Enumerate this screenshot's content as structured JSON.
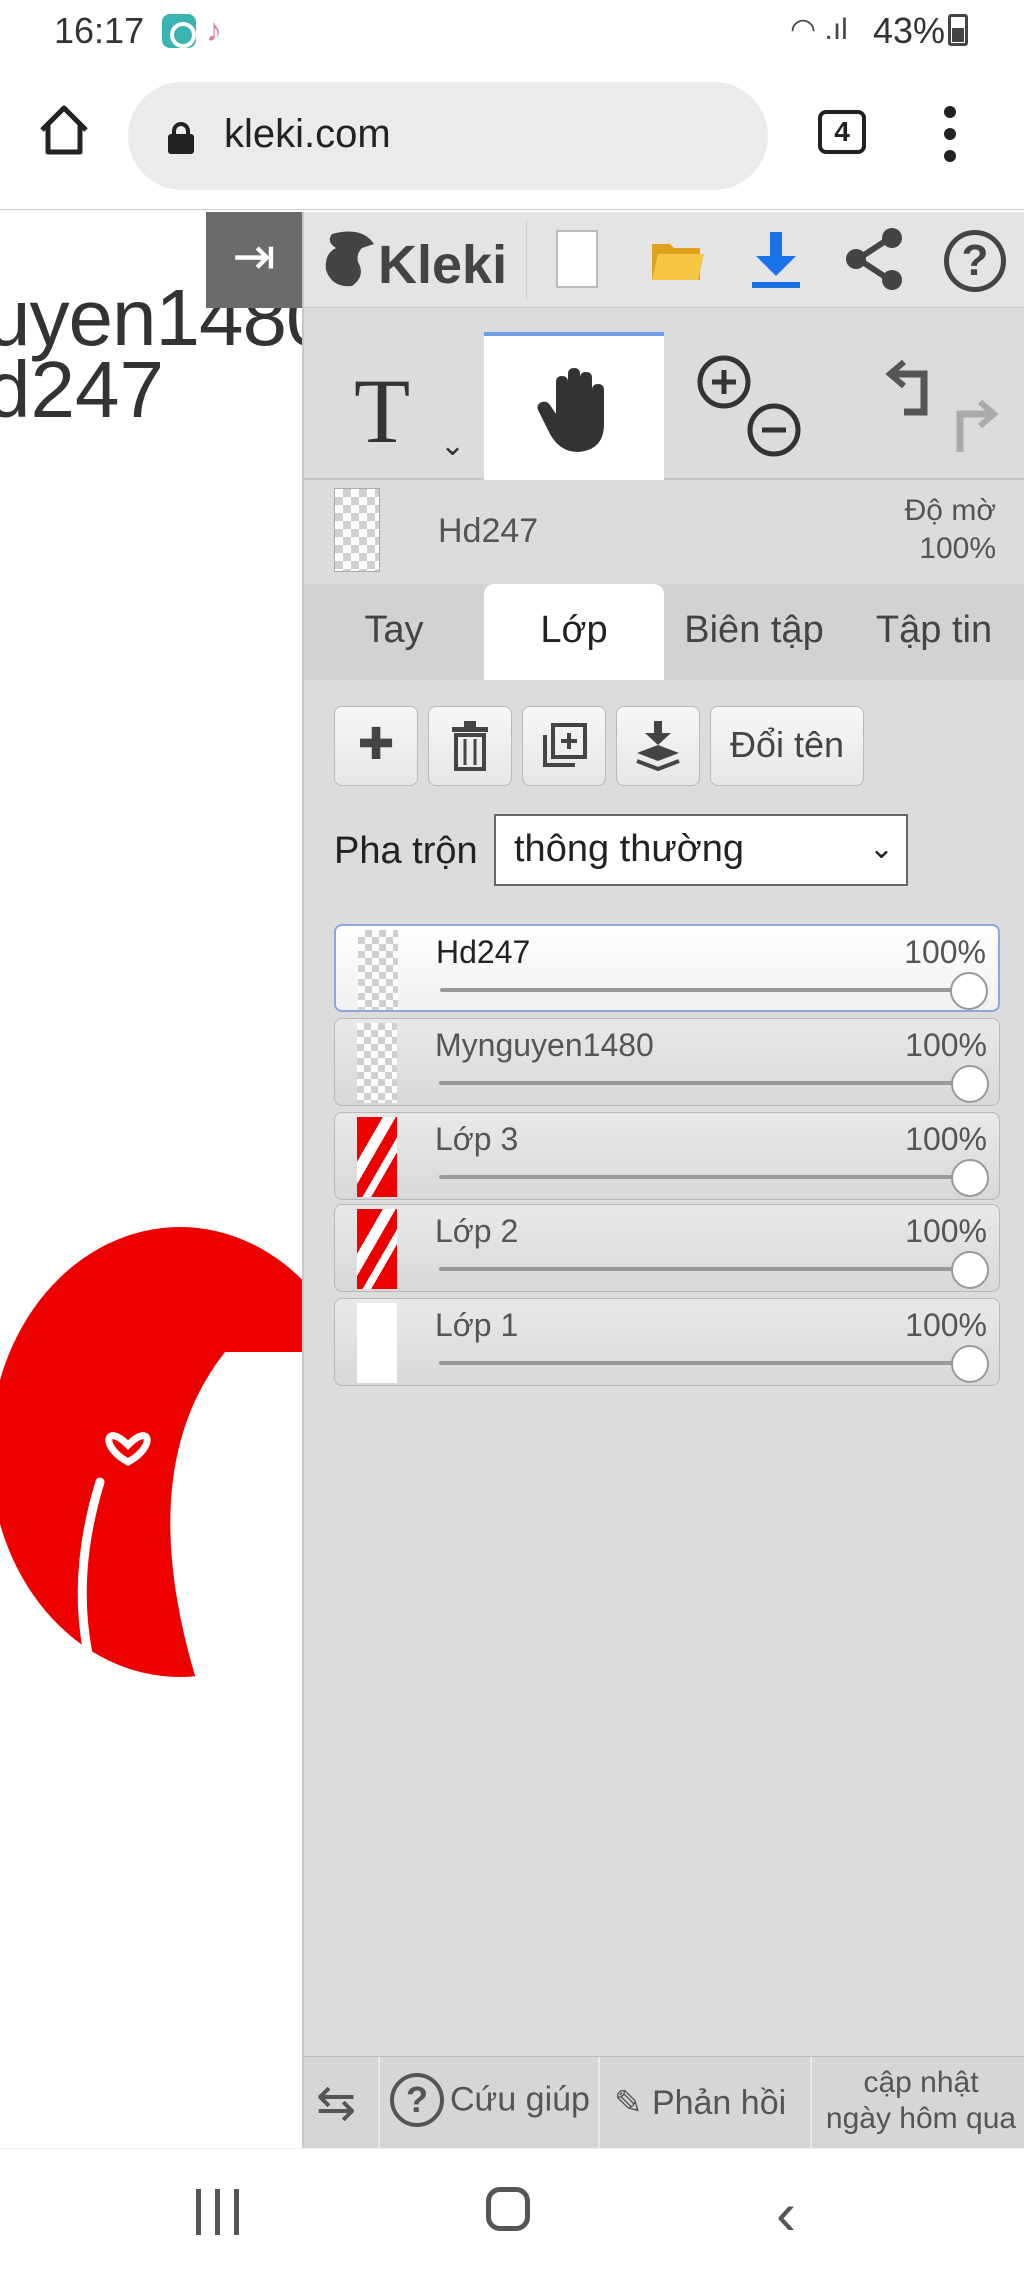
{
  "status_bar": {
    "time": "16:17",
    "battery": "43%"
  },
  "browser": {
    "url": "kleki.com",
    "tab_count": "4"
  },
  "canvas": {
    "text_line1": "uyen1480",
    "text_line2": "d247"
  },
  "app": {
    "name": "Kleki"
  },
  "layer_info": {
    "name": "Hd247",
    "opacity_label": "Độ mờ",
    "opacity_value": "100%"
  },
  "tabs": [
    {
      "label": "Tay",
      "active": false
    },
    {
      "label": "Lớp",
      "active": true
    },
    {
      "label": "Biên tập",
      "active": false
    },
    {
      "label": "Tập tin",
      "active": false
    }
  ],
  "layer_buttons": {
    "rename": "Đổi tên"
  },
  "blend": {
    "label": "Pha trộn",
    "value": "thông thường"
  },
  "layers": [
    {
      "name": "Hd247",
      "opacity": "100%",
      "opacity_fraction": 1.0,
      "selected": true,
      "thumb": "transparent"
    },
    {
      "name": "Mynguyen1480",
      "opacity": "100%",
      "opacity_fraction": 1.0,
      "selected": false,
      "thumb": "transparent"
    },
    {
      "name": "Lớp 3",
      "opacity": "100%",
      "opacity_fraction": 1.0,
      "selected": false,
      "thumb": "red"
    },
    {
      "name": "Lớp 2",
      "opacity": "100%",
      "opacity_fraction": 1.0,
      "selected": false,
      "thumb": "red"
    },
    {
      "name": "Lớp 1",
      "opacity": "100%",
      "opacity_fraction": 1.0,
      "selected": false,
      "thumb": "white"
    }
  ],
  "footer": {
    "help": "Cứu giúp",
    "feedback": "Phản hồi",
    "update_line1": "cập nhật",
    "update_line2": "ngày hôm qua"
  },
  "colors": {
    "accent_blue": "#1a73e8",
    "brand_red": "#ee0000",
    "folder_yellow": "#f2b51d"
  }
}
